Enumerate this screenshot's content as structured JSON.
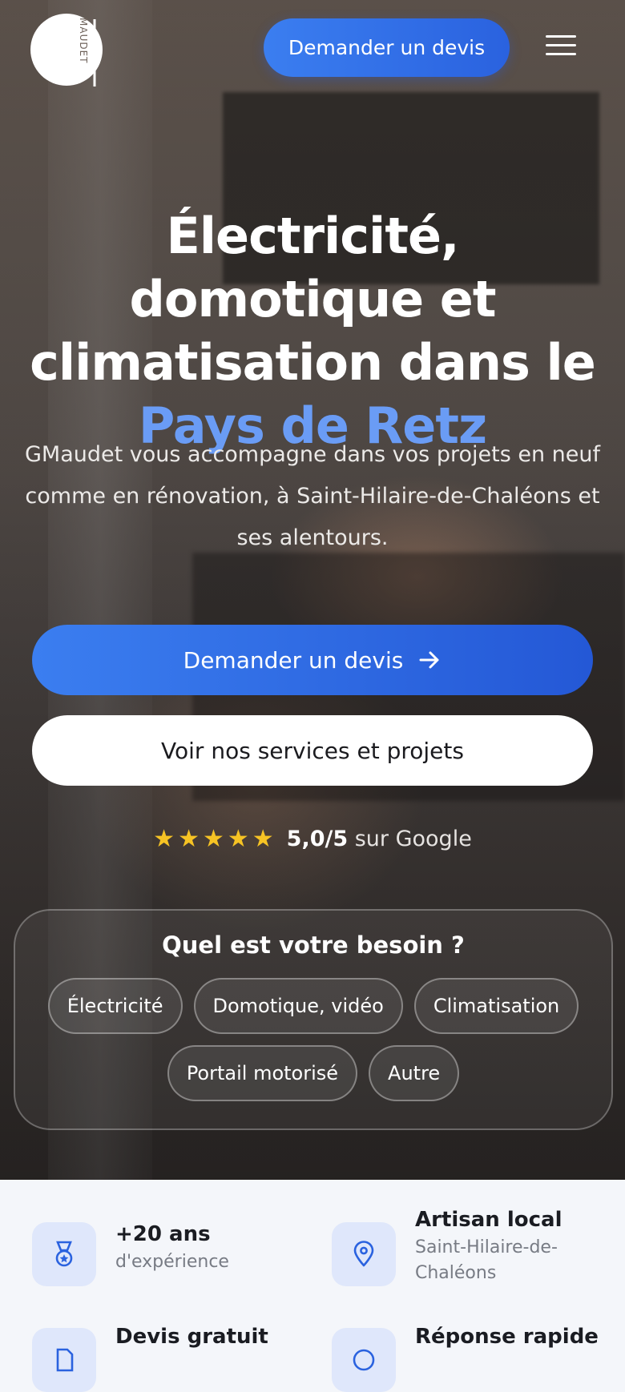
{
  "header": {
    "logo_text": "MAUDET",
    "cta_label": "Demander un devis",
    "menu_icon": "hamburger-icon"
  },
  "hero": {
    "title_part1": "Électricité, domotique et climatisation dans le ",
    "title_accent": "Pays de Retz",
    "subtitle": "GMaudet vous accompagne dans vos projets en neuf comme en rénovation, à Saint-Hilaire-de-Chaléons et ses alentours.",
    "primary_button": "Demander un devis",
    "secondary_button": "Voir nos services et projets",
    "rating_stars": 5,
    "rating_score": "5,0/5",
    "rating_source": "sur Google",
    "colors": {
      "primary": "#2a62df",
      "accent": "#6a9cf5",
      "star": "#f6c324"
    }
  },
  "needs": {
    "title": "Quel est votre besoin ?",
    "options": [
      "Électricité",
      "Domotique, vidéo",
      "Climatisation",
      "Portail motorisé",
      "Autre"
    ]
  },
  "features": [
    {
      "icon": "medal-icon",
      "title": "+20 ans",
      "desc": "d'expérience"
    },
    {
      "icon": "location-pin-icon",
      "title": "Artisan local",
      "desc": "Saint-Hilaire-de-Chaléons"
    },
    {
      "icon": "document-icon",
      "title": "Devis gratuit",
      "desc": ""
    },
    {
      "icon": "clock-icon",
      "title": "Réponse rapide",
      "desc": ""
    }
  ]
}
